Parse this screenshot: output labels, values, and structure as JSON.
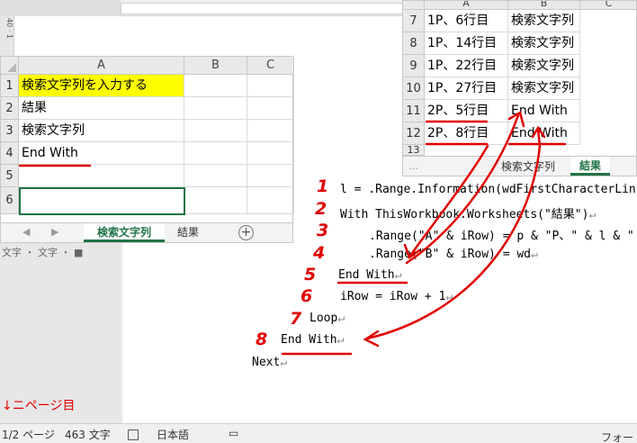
{
  "ruler": {
    "vertical_label": "40 · 1"
  },
  "sheet1": {
    "columns": [
      "A",
      "B",
      "C"
    ],
    "rows": [
      "1",
      "2",
      "3",
      "4",
      "5",
      "6"
    ],
    "cells": [
      "検索文字列を入力する",
      "結果",
      "検索文字列",
      "End With",
      "",
      ""
    ],
    "highlight_color": "#ffff00",
    "tabs": [
      "検索文字列",
      "結果"
    ]
  },
  "sheet2": {
    "columns": [
      "A",
      "B",
      "C"
    ],
    "rows": [
      {
        "num": "7",
        "a": "1P、6行目",
        "b": "検索文字列"
      },
      {
        "num": "8",
        "a": "1P、14行目",
        "b": "検索文字列"
      },
      {
        "num": "9",
        "a": "1P、22行目",
        "b": "検索文字列"
      },
      {
        "num": "10",
        "a": "1P、27行目",
        "b": "検索文字列"
      },
      {
        "num": "11",
        "a": "2P、5行目",
        "b": "End With"
      },
      {
        "num": "12",
        "a": "2P、8行目",
        "b": "End With"
      },
      {
        "num": "13",
        "a": "",
        "b": ""
      }
    ],
    "tabs": [
      "検索文字列",
      "結果"
    ]
  },
  "code_lines": [
    "l = .Range.Information(wdFirstCharacterLin",
    "With ThisWorkbook.Worksheets(\"結果\")",
    ".Range(\"A\" & iRow) = p & \"P、\" & l & \"",
    ".Range(\"B\" & iRow) = wd",
    "End With",
    "iRow = iRow + 1",
    "Loop",
    "End With",
    "Next"
  ],
  "pilcrow": "↵",
  "annotation_numbers": [
    "1",
    "2",
    "3",
    "4",
    "5",
    "6",
    "7",
    "8"
  ],
  "annotation_note": "↓ニページ目",
  "annotation_color": "#e00000",
  "left_pane_label": "文字 ・ 文字 ・ ■",
  "statusbar": {
    "page": "1/2 ページ",
    "words": "463 文字",
    "language": "日本語",
    "focus": "フォー"
  }
}
